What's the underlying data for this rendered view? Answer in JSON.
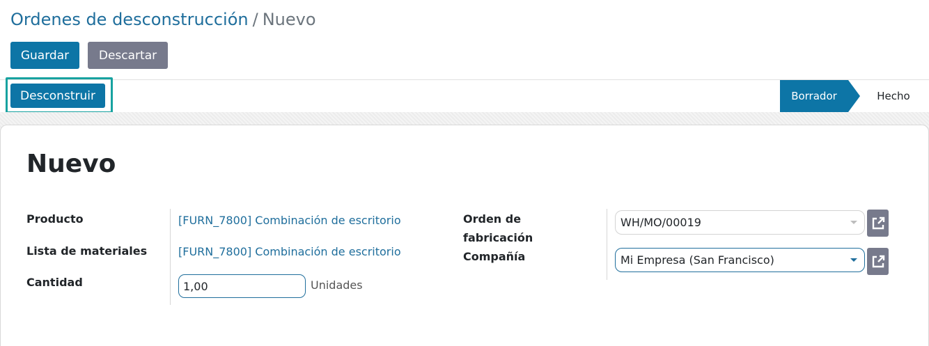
{
  "breadcrumb": {
    "parent": "Ordenes de desconstrucción",
    "separator": "/",
    "current": "Nuevo"
  },
  "toolbar": {
    "save_label": "Guardar",
    "discard_label": "Descartar"
  },
  "statusbar": {
    "action_label": "Desconstruir",
    "stages": [
      {
        "label": "Borrador",
        "active": true
      },
      {
        "label": "Hecho",
        "active": false
      }
    ]
  },
  "record": {
    "title": "Nuevo"
  },
  "form": {
    "product": {
      "label": "Producto",
      "value": "[FURN_7800] Combinación de escritorio"
    },
    "bom": {
      "label": "Lista de materiales",
      "value": "[FURN_7800] Combinación de escritorio"
    },
    "quantity": {
      "label": "Cantidad",
      "value": "1,00",
      "uom": "Unidades"
    },
    "mo": {
      "label_line1": "Orden de",
      "label_line2": "fabricación",
      "value": "WH/MO/00019"
    },
    "company": {
      "label": "Compañía",
      "value": "Mi Empresa (San Francisco)"
    }
  },
  "icons": {
    "external_link": "external-link-icon",
    "dropdown": "chevron-down-icon"
  },
  "colors": {
    "primary": "#0d75a6",
    "secondary": "#777a8c",
    "link": "#1f6e9c",
    "highlight": "#17a2a0"
  }
}
